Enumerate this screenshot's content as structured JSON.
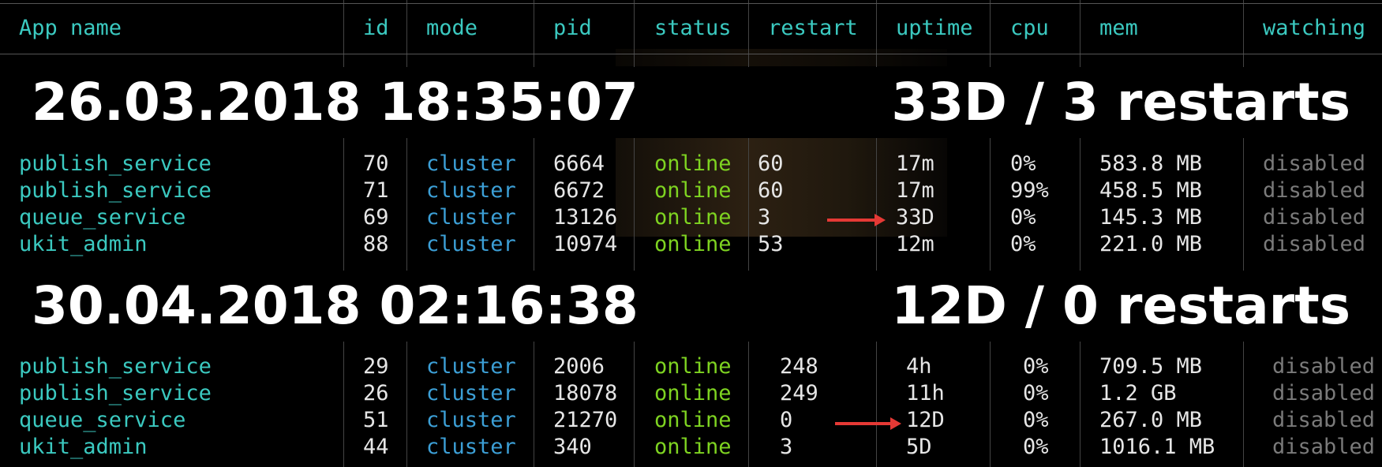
{
  "header": {
    "app_name": "App name",
    "id": "id",
    "mode": "mode",
    "pid": "pid",
    "status": "status",
    "restart": "restart",
    "uptime": "uptime",
    "cpu": "cpu",
    "mem": "mem",
    "watching": "watching"
  },
  "banner1": {
    "datetime": "26.03.2018 18:35:07",
    "summary": "33D / 3 restarts"
  },
  "banner2": {
    "datetime": "30.04.2018 02:16:38",
    "summary": "12D / 0 restarts"
  },
  "table1": {
    "rows": [
      {
        "name": "publish_service",
        "id": "70",
        "mode": "cluster",
        "pid": "6664",
        "status": "online",
        "restart": "60",
        "uptime": "17m",
        "cpu": "0%",
        "mem": "583.8 MB",
        "watching": "disabled"
      },
      {
        "name": "publish_service",
        "id": "71",
        "mode": "cluster",
        "pid": "6672",
        "status": "online",
        "restart": "60",
        "uptime": "17m",
        "cpu": "99%",
        "mem": "458.5 MB",
        "watching": "disabled"
      },
      {
        "name": "queue_service",
        "id": "69",
        "mode": "cluster",
        "pid": "13126",
        "status": "online",
        "restart": "3",
        "uptime": "33D",
        "cpu": "0%",
        "mem": "145.3 MB",
        "watching": "disabled"
      },
      {
        "name": "ukit_admin",
        "id": "88",
        "mode": "cluster",
        "pid": "10974",
        "status": "online",
        "restart": "53",
        "uptime": "12m",
        "cpu": "0%",
        "mem": "221.0 MB",
        "watching": "disabled"
      }
    ]
  },
  "table2": {
    "rows": [
      {
        "name": "publish_service",
        "id": "29",
        "mode": "cluster",
        "pid": "2006",
        "status": "online",
        "restart": "248",
        "uptime": "4h",
        "cpu": "0%",
        "mem": "709.5 MB",
        "watching": "disabled"
      },
      {
        "name": "publish_service",
        "id": "26",
        "mode": "cluster",
        "pid": "18078",
        "status": "online",
        "restart": "249",
        "uptime": "11h",
        "cpu": "0%",
        "mem": "1.2 GB",
        "watching": "disabled"
      },
      {
        "name": "queue_service",
        "id": "51",
        "mode": "cluster",
        "pid": "21270",
        "status": "online",
        "restart": "0",
        "uptime": "12D",
        "cpu": "0%",
        "mem": "267.0 MB",
        "watching": "disabled"
      },
      {
        "name": "ukit_admin",
        "id": "44",
        "mode": "cluster",
        "pid": "340",
        "status": "online",
        "restart": "3",
        "uptime": "5D",
        "cpu": "0%",
        "mem": "1016.1 MB",
        "watching": "disabled"
      }
    ]
  },
  "colors": {
    "name": "#3bc9c0",
    "mode": "#3c9fd6",
    "status_online": "#7ed321",
    "watching": "#7a7a7a",
    "arrow": "#e53935"
  }
}
